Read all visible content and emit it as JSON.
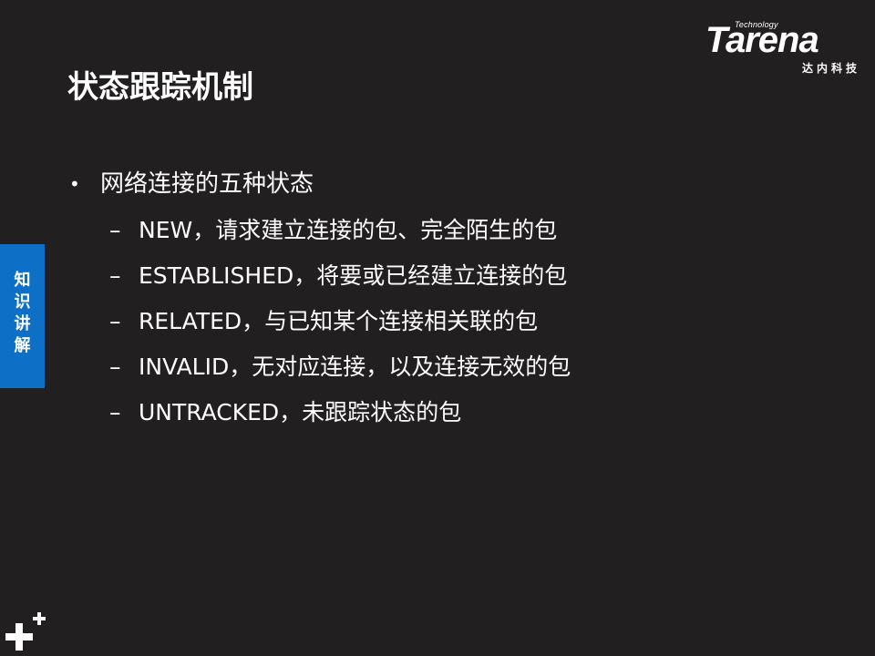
{
  "brand": {
    "tagline": "Technology",
    "name": "Tarena",
    "chinese_name": "达内科技"
  },
  "slide": {
    "title": "状态跟踪机制",
    "bullet_symbol": "•",
    "dash_symbol": "–",
    "level1": "网络连接的五种状态",
    "level2": [
      "NEW，请求建立连接的包、完全陌生的包",
      "ESTABLISHED，将要或已经建立连接的包",
      "RELATED，与已知某个连接相关联的包",
      "INVALID，无对应连接，以及连接无效的包",
      "UNTRACKED，未跟踪状态的包"
    ]
  },
  "side_tab": {
    "chars": [
      "知",
      "识",
      "讲",
      "解"
    ]
  },
  "colors": {
    "background": "#221f20",
    "side_tab": "#0d6fc6",
    "text": "#ffffff"
  },
  "icons": {
    "corner": "plus-icon"
  }
}
